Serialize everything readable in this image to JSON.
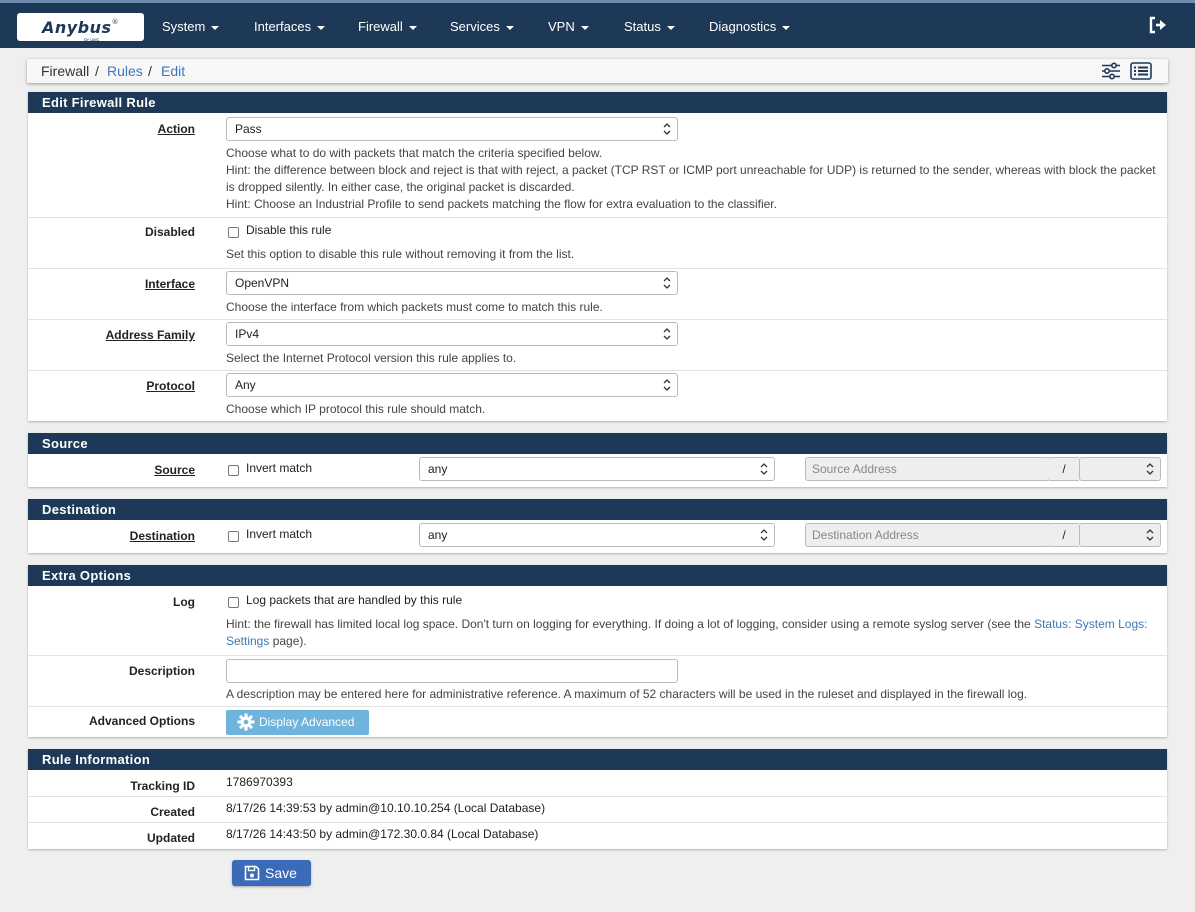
{
  "brand": {
    "name": "Anybus",
    "reg": "®",
    "sub": "BY HMS NETWORKS"
  },
  "nav": [
    {
      "label": "System"
    },
    {
      "label": "Interfaces"
    },
    {
      "label": "Firewall"
    },
    {
      "label": "Services"
    },
    {
      "label": "VPN"
    },
    {
      "label": "Status"
    },
    {
      "label": "Diagnostics"
    }
  ],
  "breadcrumb": {
    "root": "Firewall",
    "sep": "/",
    "rules": "Rules",
    "edit": "Edit"
  },
  "edit_panel": {
    "title": "Edit Firewall Rule",
    "action": {
      "label": "Action",
      "value": "Pass",
      "help1": "Choose what to do with packets that match the criteria specified below.",
      "help2": "Hint: the difference between block and reject is that with reject, a packet (TCP RST or ICMP port unreachable for UDP) is returned to the sender, whereas with block the packet",
      "help3": "is dropped silently. In either case, the original packet is discarded.",
      "help4": "Hint: Choose an Industrial Profile to send packets matching the flow for extra evaluation to the classifier."
    },
    "disabled": {
      "label": "Disabled",
      "checkbox": "Disable this rule",
      "help": "Set this option to disable this rule without removing it from the list."
    },
    "interface": {
      "label": "Interface",
      "value": "OpenVPN",
      "help": "Choose the interface from which packets must come to match this rule."
    },
    "family": {
      "label": "Address Family",
      "value": "IPv4",
      "help": "Select the Internet Protocol version this rule applies to."
    },
    "protocol": {
      "label": "Protocol",
      "value": "Any",
      "help": "Choose which IP protocol this rule should match."
    }
  },
  "source_panel": {
    "title": "Source",
    "label": "Source",
    "invert": "Invert match",
    "type": "any",
    "address_placeholder": "Source Address",
    "slash": "/"
  },
  "dest_panel": {
    "title": "Destination",
    "label": "Destination",
    "invert": "Invert match",
    "type": "any",
    "address_placeholder": "Destination Address",
    "slash": "/"
  },
  "extra_panel": {
    "title": "Extra Options",
    "log": {
      "label": "Log",
      "checkbox": "Log packets that are handled by this rule",
      "help_a": "Hint: the firewall has limited local log space. Don't turn on logging for everything. If doing a lot of logging, consider using a remote syslog server (see the",
      "help_link_a": "Status: System Logs:",
      "help_link_b": "Settings",
      "help_b": "page)."
    },
    "description": {
      "label": "Description",
      "value": "",
      "help": "A description may be entered here for administrative reference. A maximum of 52 characters will be used in the ruleset and displayed in the firewall log."
    },
    "advanced": {
      "label": "Advanced Options",
      "button": "Display Advanced"
    }
  },
  "info_panel": {
    "title": "Rule Information",
    "tracking": {
      "label": "Tracking ID",
      "value": "1786970393"
    },
    "created": {
      "label": "Created",
      "value": "8/17/26 14:39:53 by admin@10.10.10.254 (Local Database)"
    },
    "updated": {
      "label": "Updated",
      "value": "8/17/26 14:43:50 by admin@172.30.0.84 (Local Database)"
    }
  },
  "save_label": "Save",
  "colors": {
    "navbar": "#1d3957",
    "link": "#3d78b9",
    "save": "#3a6ab8",
    "advanced": "#6fb4dd"
  }
}
